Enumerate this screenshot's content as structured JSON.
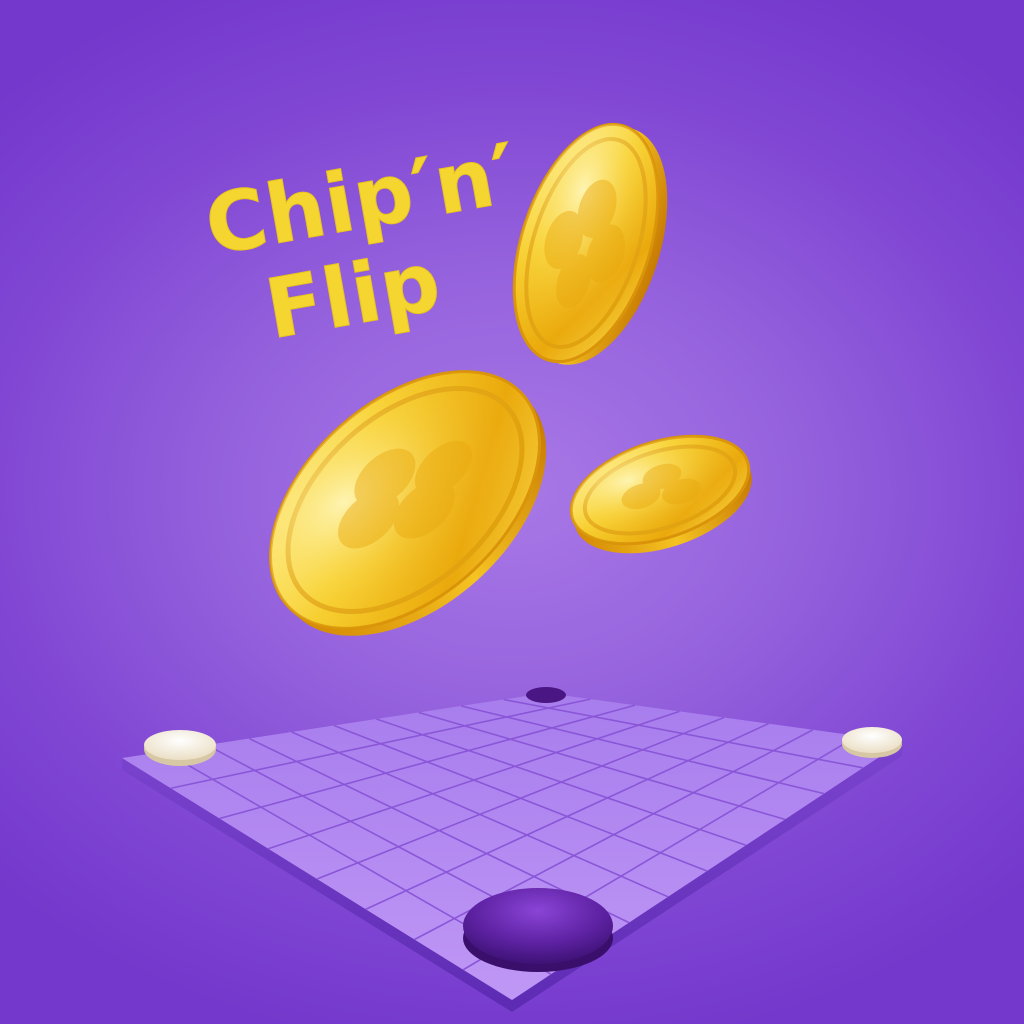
{
  "game": {
    "title_line1": "Chip′n′",
    "title_line2": "Flip"
  },
  "colors": {
    "background": "#7f45d3",
    "title": "#f5d630",
    "coin_gold": "#f2b813",
    "board_top": "#b48cf1",
    "board_grid": "#8a56d8",
    "board_side": "#6a33c2",
    "chip_white": "#f7f0e0",
    "chip_purple": "#5b1f9a"
  },
  "icons": [
    "gold-coin-icon",
    "clover-icon"
  ],
  "board": {
    "grid_rows": 8,
    "grid_cols": 10
  }
}
